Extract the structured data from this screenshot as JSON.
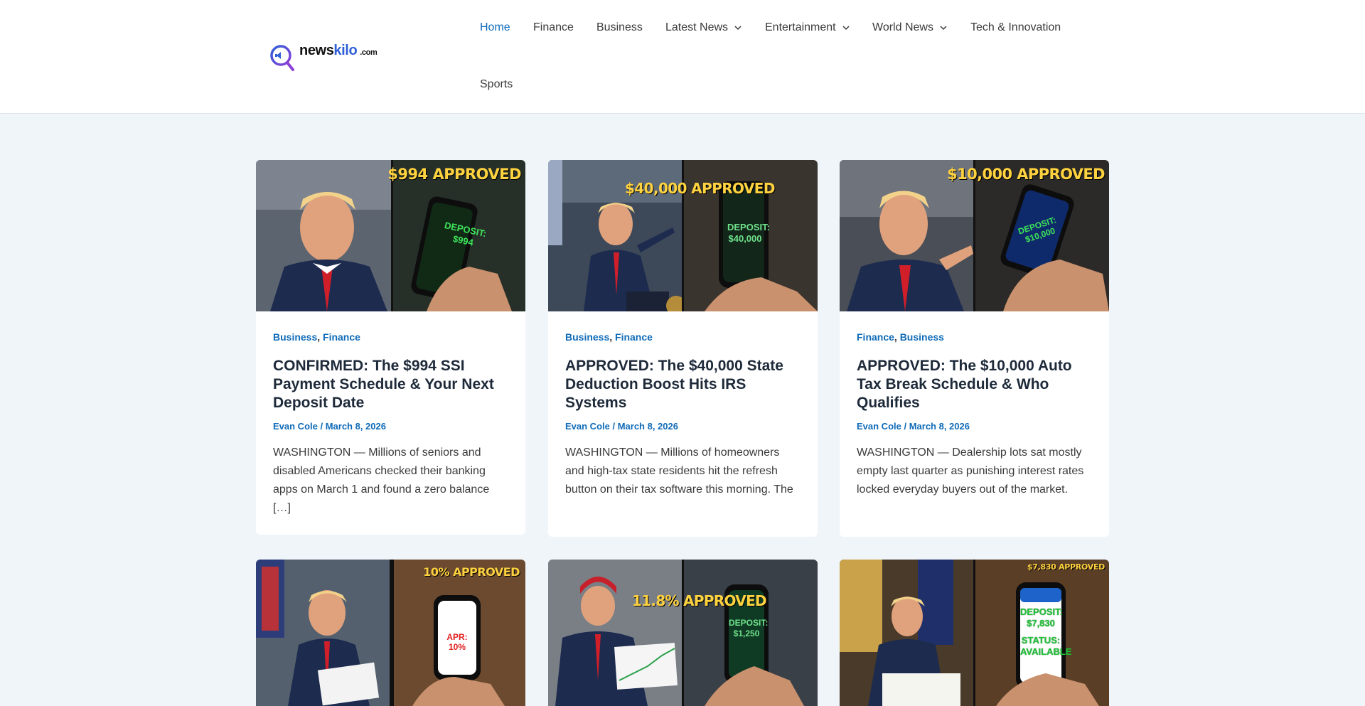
{
  "site": {
    "logo_name_part1": "news",
    "logo_name_part2": "kilo",
    "logo_tld": ".com",
    "brand_color": "#2f5fd6",
    "logo_icon": "magnifier-megaphone-icon"
  },
  "nav": {
    "items": [
      {
        "label": "Home",
        "active": true
      },
      {
        "label": "Finance"
      },
      {
        "label": "Business"
      },
      {
        "label": "Latest News",
        "dropdown": true
      },
      {
        "label": "Entertainment",
        "dropdown": true
      },
      {
        "label": "World News",
        "dropdown": true
      },
      {
        "label": "Tech & Innovation"
      },
      {
        "label": "Sports"
      }
    ]
  },
  "colors": {
    "link": "#0f6bb8",
    "background": "#f0f5fa",
    "approved_yellow": "#ffd23f",
    "deposit_green": "#3ee35a"
  },
  "posts": [
    {
      "image": {
        "headline": "$994 APPROVED",
        "phone_line1": "DEPOSIT:",
        "phone_line2": "$994"
      },
      "categories": [
        "Business",
        "Finance"
      ],
      "title": "CONFIRMED: The $994 SSI Payment Schedule & Your Next Deposit Date",
      "author": "Evan Cole",
      "meta_sep": " / ",
      "date": "March 8, 2026",
      "excerpt": "WASHINGTON — Millions of seniors and disabled Americans checked their banking apps on March 1 and found a zero balance […]"
    },
    {
      "image": {
        "headline": "$40,000 APPROVED",
        "phone_line1": "DEPOSIT:",
        "phone_line2": "$40,000"
      },
      "categories": [
        "Business",
        "Finance"
      ],
      "title": "APPROVED: The $40,000 State Deduction Boost Hits IRS Systems",
      "author": "Evan Cole",
      "meta_sep": " / ",
      "date": "March 8, 2026",
      "excerpt": "WASHINGTON — Millions of homeowners and high-tax state residents hit the refresh button on their tax software this morning. The"
    },
    {
      "image": {
        "headline": "$10,000 APPROVED",
        "phone_line1": "DEPOSIT:",
        "phone_line2": "$10,000"
      },
      "categories": [
        "Finance",
        "Business"
      ],
      "title": "APPROVED: The $10,000 Auto Tax Break Schedule & Who Qualifies",
      "author": "Evan Cole",
      "meta_sep": " / ",
      "date": "March 8, 2026",
      "excerpt": "WASHINGTON — Dealership lots sat mostly empty last quarter as punishing interest rates locked everyday buyers out of the market."
    },
    {
      "image": {
        "headline": "10% APPROVED",
        "phone_line1": "APR: 10%",
        "phone_line2": ""
      }
    },
    {
      "image": {
        "headline": "11.8% APPROVED",
        "phone_line1": "DEPOSIT:",
        "phone_line2": "$1,250"
      }
    },
    {
      "image": {
        "headline": "$7,830 APPROVED",
        "phone_line1": "DEPOSIT:",
        "phone_line2": "$7,830",
        "phone_line3": "STATUS:",
        "phone_line4": "AVAILABLE"
      }
    }
  ]
}
